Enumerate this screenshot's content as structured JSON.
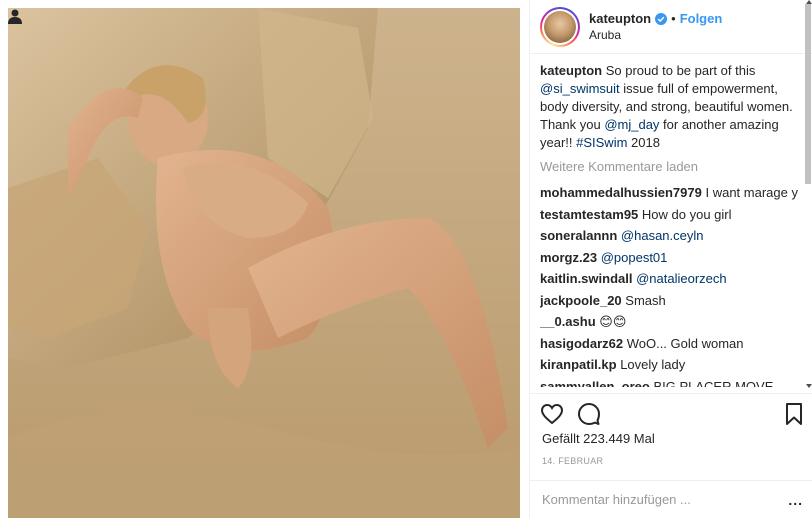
{
  "post": {
    "photo_description_icon": "user-tag-icon"
  },
  "header": {
    "username": "kateupton",
    "verified_icon": "verified-badge-icon",
    "separator": "•",
    "follow_label": "Folgen",
    "location": "Aruba"
  },
  "caption": {
    "username": "kateupton",
    "text_1": " So proud to be part of this ",
    "mention_1": "@si_swimsuit",
    "text_2": " issue full of empowerment, body diversity, and strong, beautiful women. Thank you ",
    "mention_2": "@mj_day",
    "text_3": " for another amazing year!! ",
    "hashtag": "#SISwim",
    "text_4": " 2018"
  },
  "load_more_label": "Weitere Kommentare laden",
  "comments": [
    {
      "user": "mohammedalhussien7979",
      "text": " I want marage you come to my bed",
      "mention": ""
    },
    {
      "user": "testamtestam95",
      "text": " How do you girl",
      "mention": ""
    },
    {
      "user": "soneralannn",
      "text": " ",
      "mention": "@hasan.ceyln"
    },
    {
      "user": "morgz.23",
      "text": " ",
      "mention": "@popest01"
    },
    {
      "user": "kaitlin.swindall",
      "text": " ",
      "mention": "@natalieorzech"
    },
    {
      "user": "jackpoole_20",
      "text": " Smash",
      "mention": ""
    },
    {
      "user": "__0.ashu",
      "text": " 😊😊",
      "mention": ""
    },
    {
      "user": "hasigodarz62",
      "text": " WoO... Gold woman",
      "mention": ""
    },
    {
      "user": "kiranpatil.kp",
      "text": " Lovely lady",
      "mention": ""
    },
    {
      "user": "sammyallen_oreo",
      "text": " BIG PLACER MOVE",
      "mention": ""
    }
  ],
  "actions": {
    "like_icon": "heart-icon",
    "comment_icon": "comment-bubble-icon",
    "save_icon": "bookmark-icon"
  },
  "likes_label": "Gefällt 223.449 Mal",
  "date_label": "14. FEBRUAR",
  "add_comment_placeholder": "Kommentar hinzufügen ...",
  "more_label": "...",
  "colors": {
    "link": "#003569",
    "follow": "#3897f0",
    "muted": "#999999",
    "text": "#262626",
    "border": "#efefef"
  }
}
